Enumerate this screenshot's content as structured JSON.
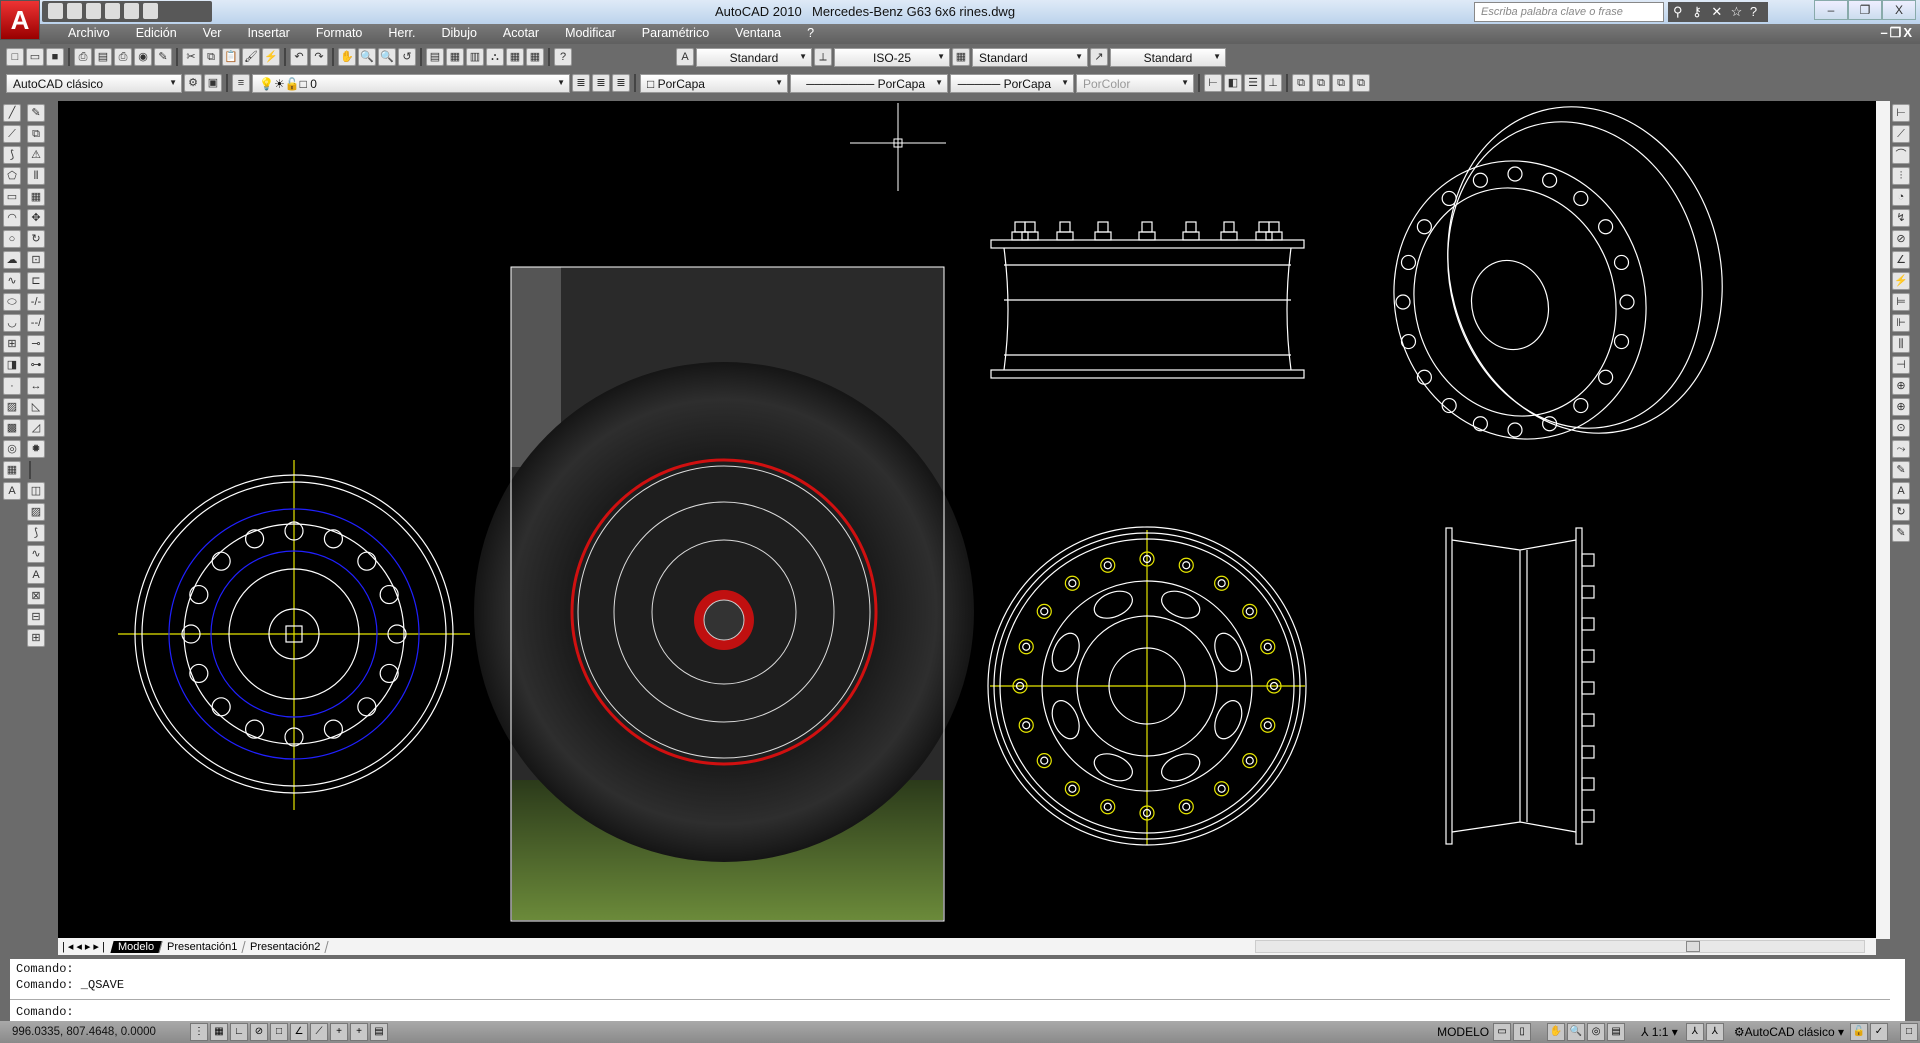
{
  "app": {
    "name": "AutoCAD 2010",
    "document": "Mercedes-Benz G63 6x6 rines.dwg",
    "logo": "A"
  },
  "search": {
    "placeholder": "Escriba palabra clave o frase"
  },
  "menu": [
    "Archivo",
    "Edición",
    "Ver",
    "Insertar",
    "Formato",
    "Herr.",
    "Dibujo",
    "Acotar",
    "Modificar",
    "Paramétrico",
    "Ventana",
    "?"
  ],
  "styles": {
    "text_style": "Standard",
    "dim_style": "ISO-25",
    "table_style": "Standard",
    "multileader_style": "Standard"
  },
  "properties": {
    "workspace": "AutoCAD clásico",
    "layer": "0",
    "color": "PorCapa",
    "linetype": "PorCapa",
    "lineweight": "PorCapa",
    "plotstyle": "PorColor"
  },
  "layout_tabs": [
    {
      "label": "Modelo",
      "active": true
    },
    {
      "label": "Presentación1"
    },
    {
      "label": "Presentación2"
    }
  ],
  "command": {
    "history": [
      "Comando:",
      "Comando:  _QSAVE"
    ],
    "prompt": "Comando:"
  },
  "status": {
    "coords": "996.0335, 807.4648, 0.0000",
    "space": "MODELO",
    "annotation_scale": "1:1",
    "workspace": "AutoCAD clásico"
  },
  "colors": {
    "canvas": "#000000",
    "centerline": "#e6e600",
    "bolt_circle": "#2020ff",
    "accent_red": "#d01010"
  },
  "window_buttons": [
    "minimize",
    "restore",
    "close"
  ]
}
